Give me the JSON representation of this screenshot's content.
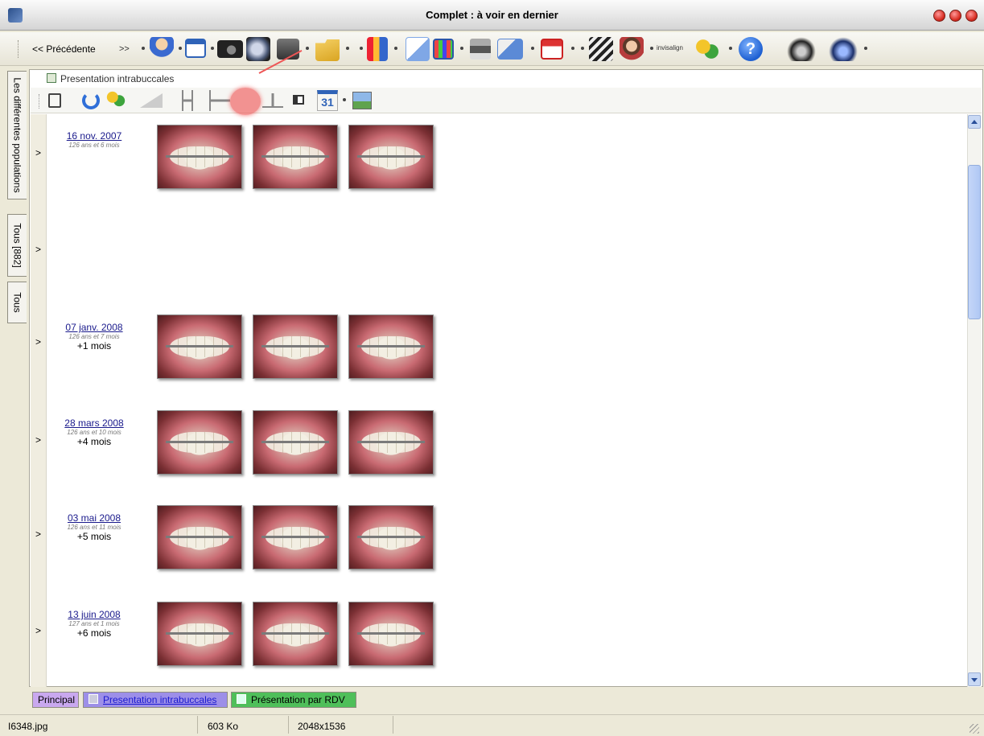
{
  "window": {
    "title": "Complet : à voir en dernier"
  },
  "toolbar": {
    "prev_label": "<< Précédente",
    "next_label": ">>",
    "invisalign_label": "invisalign"
  },
  "left_tabs": [
    {
      "label": "Les différentes populations"
    },
    {
      "label": "Tous [882]"
    },
    {
      "label": "Tous"
    }
  ],
  "panel": {
    "title": "Presentation intrabuccales",
    "calendar_label": "31"
  },
  "rows": [
    {
      "date": "16 nov. 2007",
      "age": "126 ans et 6 mois",
      "delta": "",
      "photos": 3
    },
    {
      "date": "",
      "age": "",
      "delta": "",
      "photos": 0
    },
    {
      "date": "07 janv. 2008",
      "age": "126 ans et 7 mois",
      "delta": "+1 mois",
      "photos": 3
    },
    {
      "date": "28 mars 2008",
      "age": "126 ans et 10 mois",
      "delta": "+4 mois",
      "photos": 3
    },
    {
      "date": "03 mai 2008",
      "age": "126 ans et 11 mois",
      "delta": "+5 mois",
      "photos": 3
    },
    {
      "date": "13 juin 2008",
      "age": "127 ans et 1 mois",
      "delta": "+6 mois",
      "photos": 3
    }
  ],
  "bottom_tabs": [
    {
      "label": "Principal"
    },
    {
      "label": "Presentation intrabuccales"
    },
    {
      "label": "Présentation par RDV"
    }
  ],
  "status": {
    "filename": "I6348.jpg",
    "size": "603 Ko",
    "dimensions": "2048x1536"
  },
  "colors": {
    "tab_principal": "#c9a8ef",
    "tab_intrabuccales": "#9d8fe8",
    "tab_rdv": "#4fbf5a",
    "link": "#1a1a8c"
  }
}
